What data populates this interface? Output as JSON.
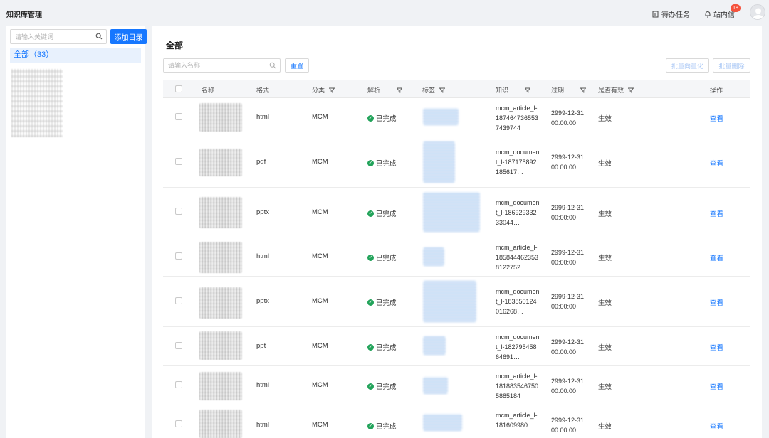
{
  "app": {
    "title": "知识库管理"
  },
  "header": {
    "todo_label": "待办任务",
    "messages_label": "站内信",
    "badge": "18"
  },
  "sidebar": {
    "search_placeholder": "请输入关键词",
    "add_button": "添加目录",
    "all_item": "全部（33）"
  },
  "main": {
    "title": "全部",
    "search_placeholder": "请输入名称",
    "reset": "重置",
    "bulk_vectorize": "批量向量化",
    "bulk_delete": "批量删除"
  },
  "table": {
    "headers": {
      "name": "名称",
      "format": "格式",
      "category": "分类",
      "parse": "解析…",
      "tags": "标签",
      "knowledge": "知识…",
      "expire": "过期…",
      "valid": "是否有效",
      "action": "操作"
    },
    "rows": [
      {
        "format": "html",
        "category": "MCM",
        "status": "已完成",
        "kid": "mcm_article_l-1874647365537439744",
        "expire": "2999-12-31 00:00:00",
        "valid": "生效",
        "action": "查看"
      },
      {
        "format": "pdf",
        "category": "MCM",
        "status": "已完成",
        "kid": "mcm_document_l-187175892185617…",
        "expire": "2999-12-31 00:00:00",
        "valid": "生效",
        "action": "查看"
      },
      {
        "format": "pptx",
        "category": "MCM",
        "status": "已完成",
        "kid": "mcm_document_l-18692933233044…",
        "expire": "2999-12-31 00:00:00",
        "valid": "生效",
        "action": "查看"
      },
      {
        "format": "html",
        "category": "MCM",
        "status": "已完成",
        "kid": "mcm_article_l-1858444623538122752",
        "expire": "2999-12-31 00:00:00",
        "valid": "生效",
        "action": "查看"
      },
      {
        "format": "pptx",
        "category": "MCM",
        "status": "已完成",
        "kid": "mcm_document_l-183850124016268…",
        "expire": "2999-12-31 00:00:00",
        "valid": "生效",
        "action": "查看"
      },
      {
        "format": "ppt",
        "category": "MCM",
        "status": "已完成",
        "kid": "mcm_document_l-18279545864691…",
        "expire": "2999-12-31 00:00:00",
        "valid": "生效",
        "action": "查看"
      },
      {
        "format": "html",
        "category": "MCM",
        "status": "已完成",
        "kid": "mcm_article_l-1818835467505885184",
        "expire": "2999-12-31 00:00:00",
        "valid": "生效",
        "action": "查看"
      },
      {
        "format": "html",
        "category": "MCM",
        "status": "已完成",
        "kid": "mcm_article_l-181609980",
        "expire": "2999-12-31 00:00:00",
        "valid": "生效",
        "action": "查看"
      }
    ]
  },
  "colors": {
    "primary": "#1677ff",
    "success": "#22a35a",
    "badge": "#f5533d"
  }
}
